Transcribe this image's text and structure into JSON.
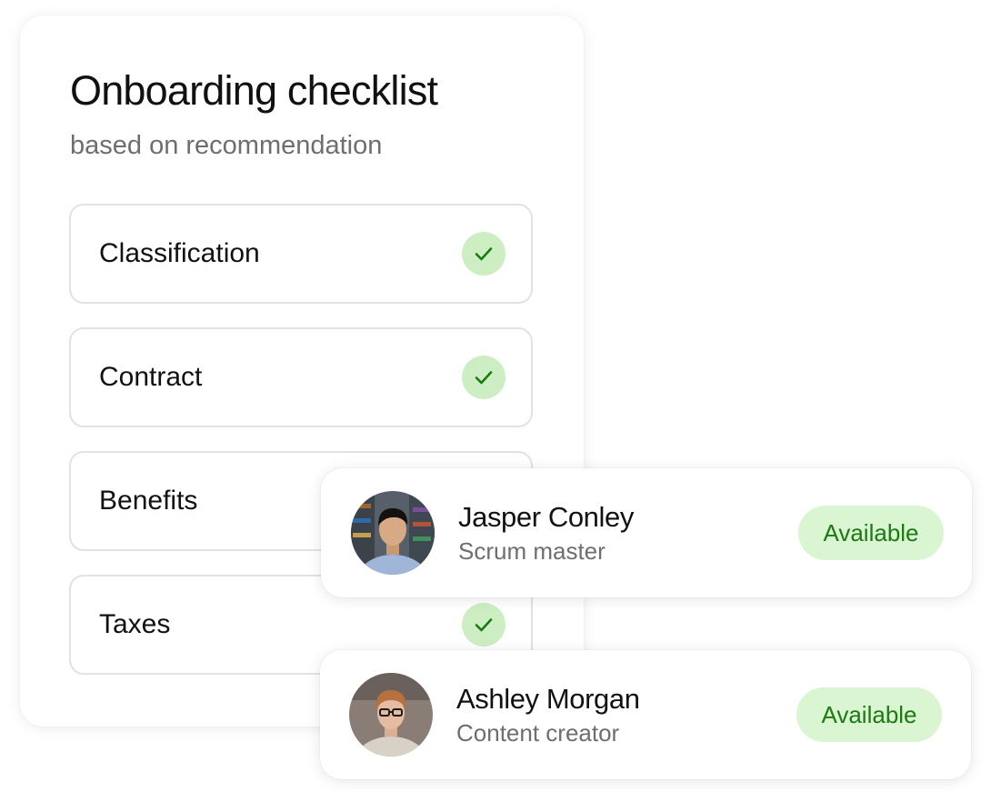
{
  "checklist": {
    "title": "Onboarding checklist",
    "subtitle": "based on recommendation",
    "items": [
      {
        "label": "Classification",
        "completed": true
      },
      {
        "label": "Contract",
        "completed": true
      },
      {
        "label": "Benefits",
        "completed": true
      },
      {
        "label": "Taxes",
        "completed": true
      }
    ],
    "check_icon": "checkmark-icon",
    "check_color": "#1b7a12",
    "check_bg": "#cdeec3"
  },
  "people": [
    {
      "name": "Jasper Conley",
      "role": "Scrum master",
      "status": "Available",
      "avatar_icon": "avatar-photo"
    },
    {
      "name": "Ashley Morgan",
      "role": "Content creator",
      "status": "Available",
      "avatar_icon": "avatar-photo"
    }
  ],
  "colors": {
    "status_text": "#1b7a12",
    "status_bg": "#d9f5d1",
    "muted_text": "#6e6e6e",
    "primary_text": "#111111"
  }
}
